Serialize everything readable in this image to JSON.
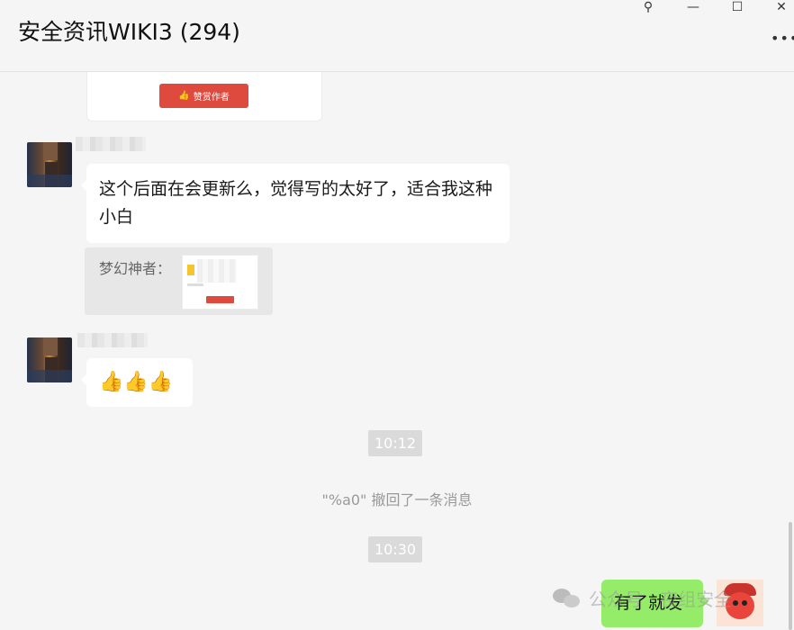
{
  "window": {
    "title": "安全资讯WIKI3 (294)",
    "controls": {
      "pin": "⚲",
      "minimize": "—",
      "maximize": "☐",
      "close": "✕"
    },
    "more_label": "•••"
  },
  "messages": {
    "prev_card": {
      "button_label": "赞赏作者",
      "button_icon": "👍"
    },
    "msg1": {
      "text": "这个后面在会更新么，觉得写的太好了，适合我这种小白"
    },
    "quote": {
      "label": "梦幻神者："
    },
    "msg2": {
      "emoji": "👍👍👍"
    },
    "time1": "10:12",
    "recall": "\"%a0\" 撤回了一条消息",
    "time2": "10:30",
    "mine": {
      "text": "有了就发"
    }
  },
  "watermark": {
    "text": "公众号 · 夜组安全"
  }
}
